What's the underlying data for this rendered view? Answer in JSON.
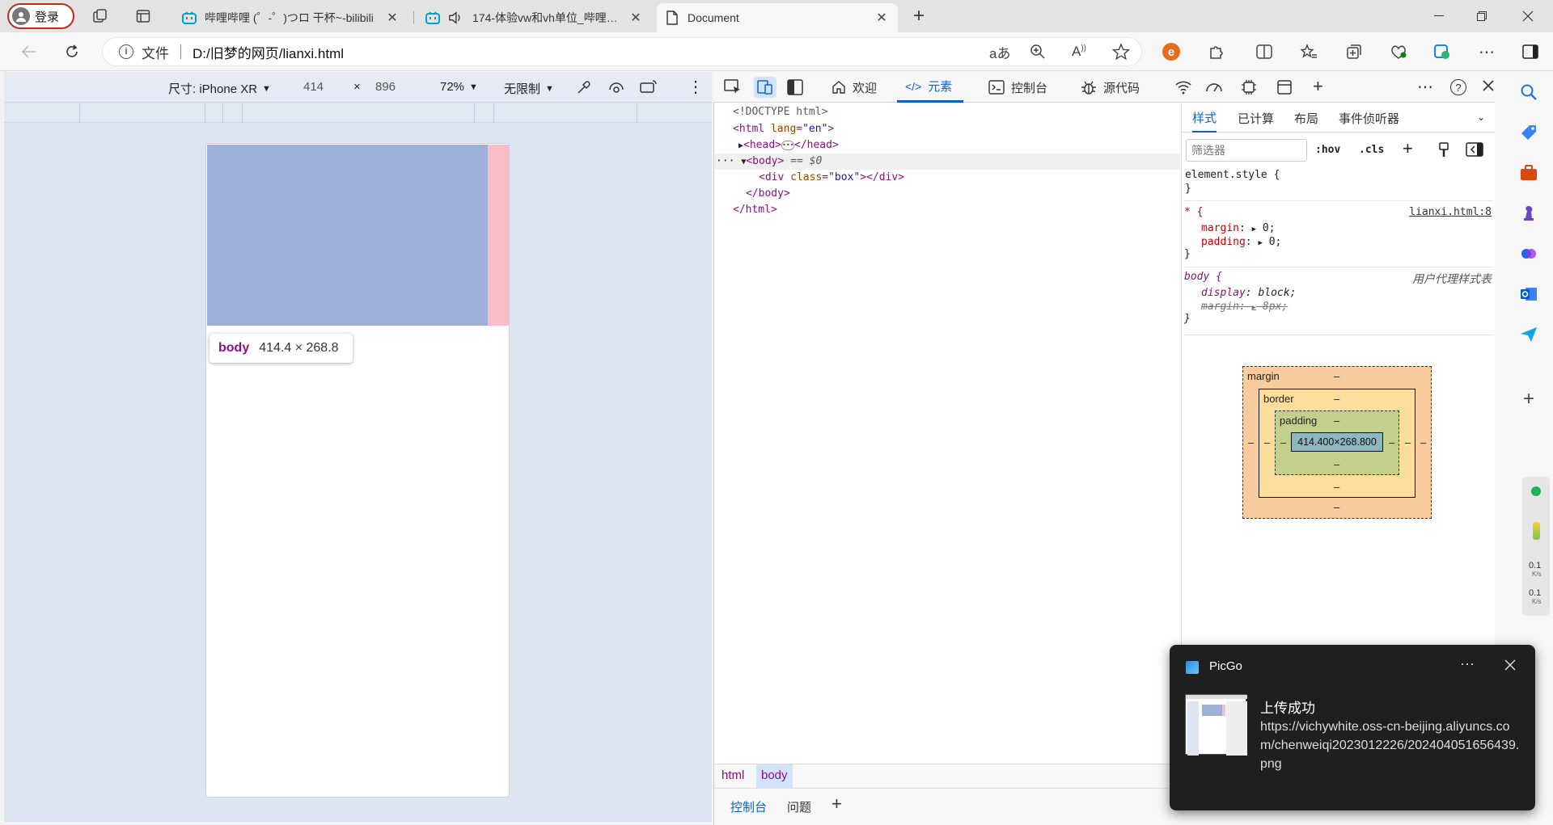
{
  "browser": {
    "profile_label": "登录",
    "tabs": [
      {
        "title": "哔哩哔哩 (゜-゜)つロ 干杯~-bilibili"
      },
      {
        "title": "174-体验vw和vh单位_哔哩哔哩"
      },
      {
        "title": "Document"
      }
    ],
    "address": {
      "scheme_label": "文件",
      "url": "D:/旧梦的网页/lianxi.html"
    }
  },
  "device_toolbar": {
    "dimensions_label": "尺寸: iPhone XR",
    "width": "414",
    "times": "×",
    "height": "896",
    "zoom": "72%",
    "throttle": "无限制"
  },
  "viewport": {
    "tooltip": {
      "tag": "body",
      "size": "414.4 × 268.8"
    },
    "box_color": "#9fb0d8",
    "strip_color": "#f9bcc9"
  },
  "devtools": {
    "tabs": [
      "欢迎",
      "元素",
      "控制台",
      "源代码"
    ],
    "active_tab": "元素",
    "dom": {
      "doctype": "<!DOCTYPE html>",
      "html_open": "<html",
      "html_attr": "lang",
      "html_val": "\"en\"",
      "head_open": "<head>",
      "head_close": "</head>",
      "body_open": "<body>",
      "body_sel": "== $0",
      "div_open": "<div",
      "div_attr": "class",
      "div_val": "\"box\"",
      "div_close": "></div>",
      "body_close": "</body>",
      "html_close": "</html>"
    },
    "breadcrumbs": [
      "html",
      "body"
    ],
    "drawer_tabs": [
      "控制台",
      "问题"
    ],
    "styles": {
      "tabs": [
        "样式",
        "已计算",
        "布局",
        "事件侦听器"
      ],
      "filter_placeholder": "筛选器",
      "hov": ":hov",
      "cls": ".cls",
      "element_style": "element.style {",
      "close_brace": "}",
      "star_selector": "* {",
      "star_source": "lianxi.html:8",
      "margin_prop": "margin",
      "padding_prop": "padding",
      "zero": "0;",
      "body_selector": "body {",
      "ua_label": "用户代理样式表",
      "display_prop": "display",
      "display_val": "block;",
      "margin_strike": "8px;"
    },
    "box_model": {
      "margin_label": "margin",
      "border_label": "border",
      "padding_label": "padding",
      "content": "414.400×268.800",
      "dash": "–"
    }
  },
  "sidebar": {
    "net_up": "0.1",
    "net_up_unit": "K/s",
    "net_down": "0.1",
    "net_down_unit": "K/s"
  },
  "toast": {
    "app": "PicGo",
    "title": "上传成功",
    "body": "https://vichywhite.oss-cn-beijing.aliyuncs.com/chenweiqi2023012226/202404051656439.png"
  }
}
